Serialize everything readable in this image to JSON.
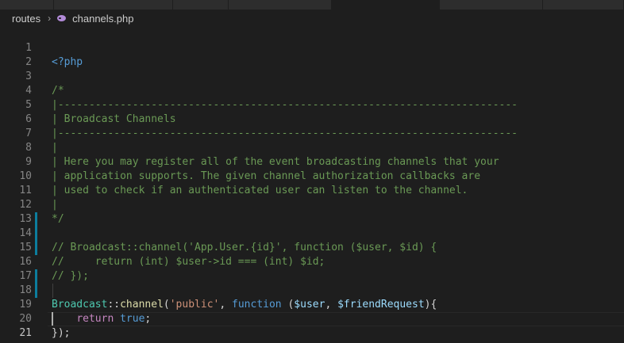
{
  "breadcrumb": {
    "folder": "routes",
    "file": "channels.php"
  },
  "lines": [
    {
      "n": "1",
      "code": "<?php"
    },
    {
      "n": "2",
      "code": ""
    },
    {
      "n": "3",
      "code": "/*"
    },
    {
      "n": "4",
      "code": "|--------------------------------------------------------------------------"
    },
    {
      "n": "5",
      "code": "| Broadcast Channels"
    },
    {
      "n": "6",
      "code": "|--------------------------------------------------------------------------"
    },
    {
      "n": "7",
      "code": "|"
    },
    {
      "n": "8",
      "code": "| Here you may register all of the event broadcasting channels that your"
    },
    {
      "n": "9",
      "code": "| application supports. The given channel authorization callbacks are"
    },
    {
      "n": "10",
      "code": "| used to check if an authenticated user can listen to the channel."
    },
    {
      "n": "11",
      "code": "|"
    },
    {
      "n": "12",
      "code": "*/"
    },
    {
      "n": "13",
      "code": ""
    },
    {
      "n": "14",
      "code": "// Broadcast::channel('App.User.{id}', function ($user, $id) {"
    },
    {
      "n": "15",
      "code": "//     return (int) $user->id === (int) $id;"
    },
    {
      "n": "16",
      "code": "// });"
    },
    {
      "n": "17",
      "code": ""
    },
    {
      "n": "18",
      "code": "Broadcast::channel('public', function ($user, $friendRequest){"
    },
    {
      "n": "19",
      "code": "    return true;"
    },
    {
      "n": "20",
      "code": "});"
    },
    {
      "n": "21",
      "code": ""
    }
  ],
  "tokens": {
    "l18_class": "Broadcast",
    "l18_op": "::",
    "l18_fn": "channel",
    "l18_paren": "(",
    "l18_str": "'public'",
    "l18_comma": ", ",
    "l18_kw": "function",
    "l18_paren2": " (",
    "l18_var1": "$user",
    "l18_comma2": ", ",
    "l18_var2": "$friendRequest",
    "l18_end": "){",
    "l19_indent": "    ",
    "l19_kw": "return",
    "l19_sp": " ",
    "l19_val": "true",
    "l19_end": ";",
    "l20": "});"
  },
  "colors": {
    "background": "#1e1e1e",
    "comment": "#6a9955",
    "keyword": "#569cd6",
    "class": "#4ec9b0",
    "function": "#dcdcaa",
    "string": "#ce9178",
    "variable": "#9cdcfe",
    "modified_gutter": "#0c7d9d"
  }
}
